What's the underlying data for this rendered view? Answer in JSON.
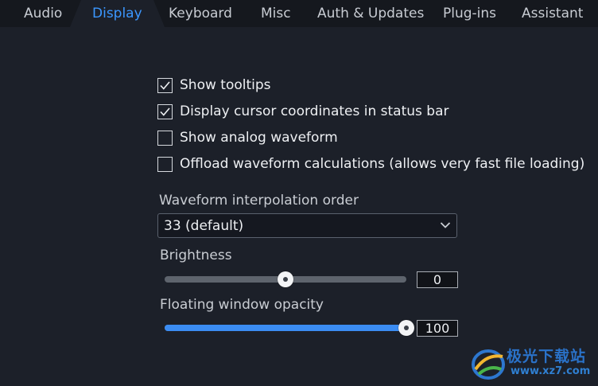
{
  "tabs": [
    {
      "label": "Audio",
      "active": false
    },
    {
      "label": "Display",
      "active": true
    },
    {
      "label": "Keyboard",
      "active": false
    },
    {
      "label": "Misc",
      "active": false
    },
    {
      "label": "Auth & Updates",
      "active": false
    },
    {
      "label": "Plug-ins",
      "active": false
    },
    {
      "label": "Assistant",
      "active": false
    }
  ],
  "options": [
    {
      "label": "Show tooltips",
      "checked": true
    },
    {
      "label": "Display cursor coordinates in status bar",
      "checked": true
    },
    {
      "label": "Show analog waveform",
      "checked": false
    },
    {
      "label": "Offload waveform calculations (allows very fast file loading)",
      "checked": false
    }
  ],
  "interpolation": {
    "label": "Waveform interpolation order",
    "value": "33 (default)"
  },
  "brightness": {
    "label": "Brightness",
    "value": "0",
    "fraction": 0.5
  },
  "opacity": {
    "label": "Floating window opacity",
    "value": "100",
    "fraction": 1.0
  },
  "colors": {
    "accent": "#3b97ff",
    "background": "#1c2029",
    "tabbar": "#15181e"
  },
  "watermark": {
    "brand": "极光下载站",
    "url": "www.xz7.com"
  }
}
